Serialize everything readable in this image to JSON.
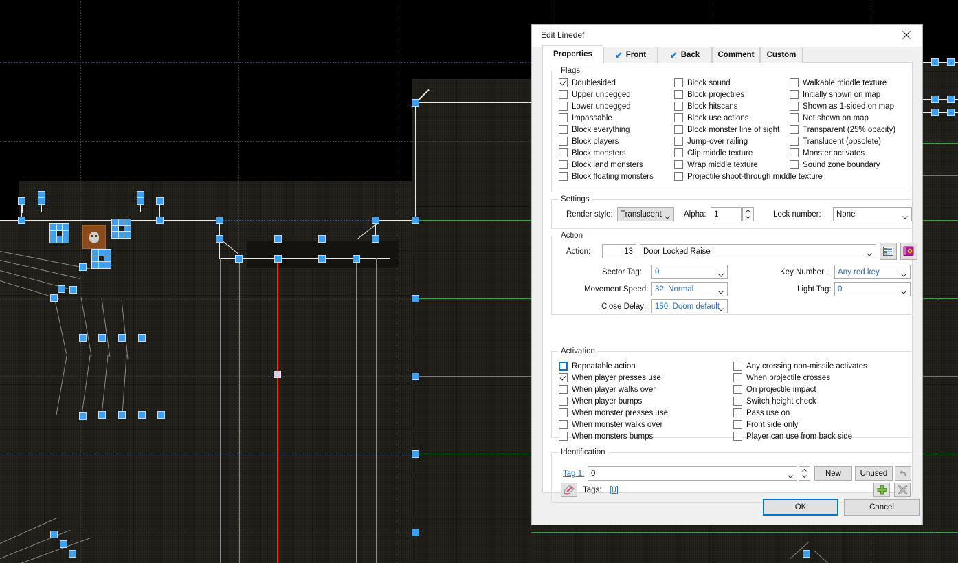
{
  "window": {
    "title": "Edit Linedef",
    "close_icon": "close-icon"
  },
  "tabs": [
    {
      "label": "Properties",
      "check": "",
      "active": true
    },
    {
      "label": "Front",
      "check": "✔",
      "active": false
    },
    {
      "label": "Back",
      "check": "✔",
      "active": false
    },
    {
      "label": "Comment",
      "check": "",
      "active": false
    },
    {
      "label": "Custom",
      "check": "",
      "active": false
    }
  ],
  "flags": {
    "title": "Flags",
    "col1": [
      {
        "label": "Doublesided",
        "checked": true
      },
      {
        "label": "Upper unpegged",
        "checked": false
      },
      {
        "label": "Lower unpegged",
        "checked": false
      },
      {
        "label": "Impassable",
        "checked": false
      },
      {
        "label": "Block everything",
        "checked": false
      },
      {
        "label": "Block players",
        "checked": false
      },
      {
        "label": "Block monsters",
        "checked": false
      },
      {
        "label": "Block land monsters",
        "checked": false
      },
      {
        "label": "Block floating monsters",
        "checked": false
      }
    ],
    "col2": [
      {
        "label": "Block sound",
        "checked": false
      },
      {
        "label": "Block projectiles",
        "checked": false
      },
      {
        "label": "Block hitscans",
        "checked": false
      },
      {
        "label": "Block use actions",
        "checked": false
      },
      {
        "label": "Block monster line of sight",
        "checked": false
      },
      {
        "label": "Jump-over railing",
        "checked": false
      },
      {
        "label": "Clip middle texture",
        "checked": false
      },
      {
        "label": "Wrap middle texture",
        "checked": false
      },
      {
        "label": "Projectile shoot-through middle texture",
        "checked": false
      }
    ],
    "col3": [
      {
        "label": "Walkable middle texture",
        "checked": false
      },
      {
        "label": "Initially shown on map",
        "checked": false
      },
      {
        "label": "Shown as 1-sided on map",
        "checked": false
      },
      {
        "label": "Not shown on map",
        "checked": false
      },
      {
        "label": "Transparent (25% opacity)",
        "checked": false
      },
      {
        "label": "Translucent (obsolete)",
        "checked": false
      },
      {
        "label": "Monster activates",
        "checked": false
      },
      {
        "label": "Sound zone boundary",
        "checked": false
      }
    ]
  },
  "settings": {
    "title": "Settings",
    "render_style_label": "Render style:",
    "render_style_value": "Translucent",
    "alpha_label": "Alpha:",
    "alpha_value": "1",
    "lock_number_label": "Lock number:",
    "lock_number_value": "None"
  },
  "action": {
    "title": "Action",
    "action_label": "Action:",
    "action_number": "13",
    "action_name": "Door Locked Raise",
    "browse_icon": "list-browse-icon",
    "script_icon": "script-book-icon",
    "sector_tag_label": "Sector Tag:",
    "sector_tag_value": "0",
    "movement_speed_label": "Movement Speed:",
    "movement_speed_value": "32: Normal",
    "close_delay_label": "Close Delay:",
    "close_delay_value": "150: Doom default",
    "key_number_label": "Key Number:",
    "key_number_value": "Any red key",
    "light_tag_label": "Light Tag:",
    "light_tag_value": "0"
  },
  "activation": {
    "title": "Activation",
    "col1": [
      {
        "label": "Repeatable action",
        "checked": false,
        "focused": true
      },
      {
        "label": "When player presses use",
        "checked": true,
        "focused": false
      },
      {
        "label": "When player walks over",
        "checked": false,
        "focused": false
      },
      {
        "label": "When player bumps",
        "checked": false,
        "focused": false
      },
      {
        "label": "When monster presses use",
        "checked": false,
        "focused": false
      },
      {
        "label": "When monster walks over",
        "checked": false,
        "focused": false
      },
      {
        "label": "When monsters bumps",
        "checked": false,
        "focused": false
      }
    ],
    "col2": [
      {
        "label": "Any crossing non-missile activates",
        "checked": false,
        "focused": false
      },
      {
        "label": "When projectile crosses",
        "checked": false,
        "focused": false
      },
      {
        "label": "On projectile impact",
        "checked": false,
        "focused": false
      },
      {
        "label": "Switch height check",
        "checked": false,
        "focused": false
      },
      {
        "label": "Pass use on",
        "checked": false,
        "focused": false
      },
      {
        "label": "Front side only",
        "checked": false,
        "focused": false
      },
      {
        "label": "Player can use from back side",
        "checked": false,
        "focused": false
      }
    ]
  },
  "identification": {
    "title": "Identification",
    "tag1_label": "Tag 1:",
    "tag1_value": "0",
    "new_label": "New",
    "unused_label": "Unused",
    "undo_icon": "undo-arrow-icon",
    "clear_tags_icon": "eraser-icon",
    "tags_label": "Tags:",
    "tags_value": "[0]",
    "add_icon": "plus-icon",
    "remove_icon": "remove-x-icon"
  },
  "footer": {
    "ok_label": "OK",
    "cancel_label": "Cancel"
  },
  "colors": {
    "accent": "#0078d7",
    "tab_check": "#1a7fd4",
    "combo_blue_text": "#2b6fc0",
    "link": "#2b6fc0",
    "selected_linedef": "#ff2a00",
    "vertex": "#3fa0f0",
    "sector_line_green": "#3f9e4d"
  },
  "map": {
    "name": "doom-map-editor-canvas",
    "grid_color": "#2a3a63",
    "background": "#000000"
  }
}
